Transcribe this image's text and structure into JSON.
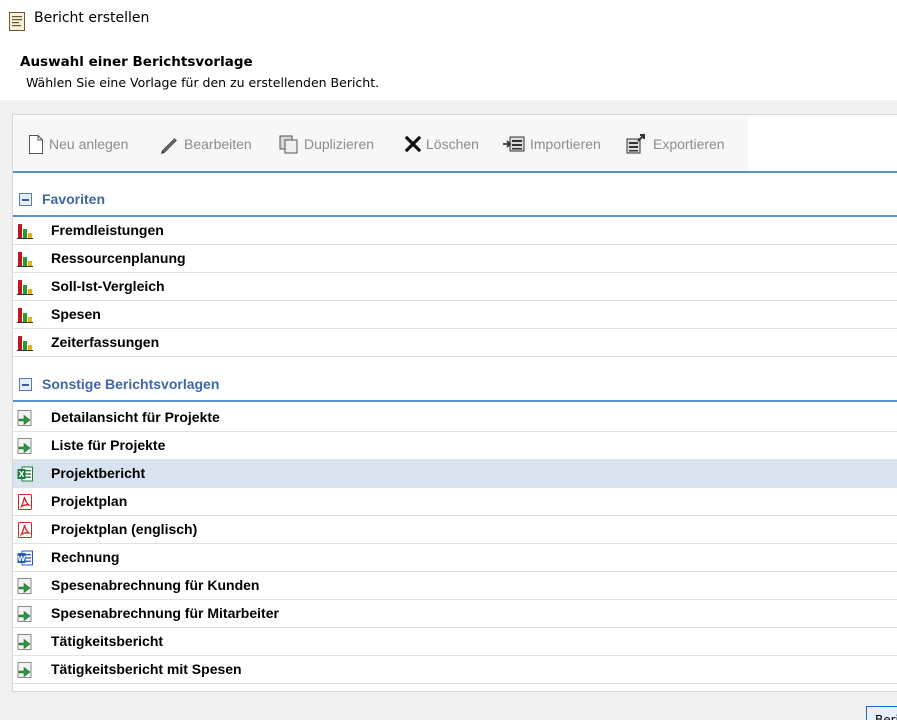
{
  "window": {
    "title": "Bericht erstellen"
  },
  "header": {
    "title": "Auswahl einer Berichtsvorlage",
    "subtitle": "Wählen Sie eine Vorlage für den zu erstellenden Bericht."
  },
  "toolbar": {
    "new_label": "Neu anlegen",
    "edit_label": "Bearbeiten",
    "duplicate_label": "Duplizieren",
    "delete_label": "Löschen",
    "import_label": "Importieren",
    "export_label": "Exportieren"
  },
  "groups": [
    {
      "label": "Favoriten",
      "items": [
        {
          "label": "Fremdleistungen",
          "icon": "bar-chart-icon"
        },
        {
          "label": "Ressourcenplanung",
          "icon": "bar-chart-icon"
        },
        {
          "label": "Soll-Ist-Vergleich",
          "icon": "bar-chart-icon"
        },
        {
          "label": "Spesen",
          "icon": "bar-chart-icon"
        },
        {
          "label": "Zeiterfassungen",
          "icon": "bar-chart-icon"
        }
      ]
    },
    {
      "label": "Sonstige Berichtsvorlagen",
      "items": [
        {
          "label": "Detailansicht für Projekte",
          "icon": "report-arrow-icon"
        },
        {
          "label": "Liste für Projekte",
          "icon": "report-arrow-icon"
        },
        {
          "label": "Projektbericht",
          "icon": "excel-icon",
          "selected": true
        },
        {
          "label": "Projektplan",
          "icon": "pdf-icon"
        },
        {
          "label": "Projektplan (englisch)",
          "icon": "pdf-icon"
        },
        {
          "label": "Rechnung",
          "icon": "word-icon"
        },
        {
          "label": "Spesenabrechnung für Kunden",
          "icon": "report-arrow-icon"
        },
        {
          "label": "Spesenabrechnung für Mitarbeiter",
          "icon": "report-arrow-icon"
        },
        {
          "label": "Tätigkeitsbericht",
          "icon": "report-arrow-icon"
        },
        {
          "label": "Tätigkeitsbericht mit Spesen",
          "icon": "report-arrow-icon"
        }
      ]
    }
  ],
  "footer": {
    "button_label": "Beri"
  },
  "colors": {
    "accent": "#5b8fc7",
    "group_label": "#3f67a8",
    "selected_row": "#d9e3ef",
    "toolbar_disabled_text": "#8c8c8c"
  }
}
